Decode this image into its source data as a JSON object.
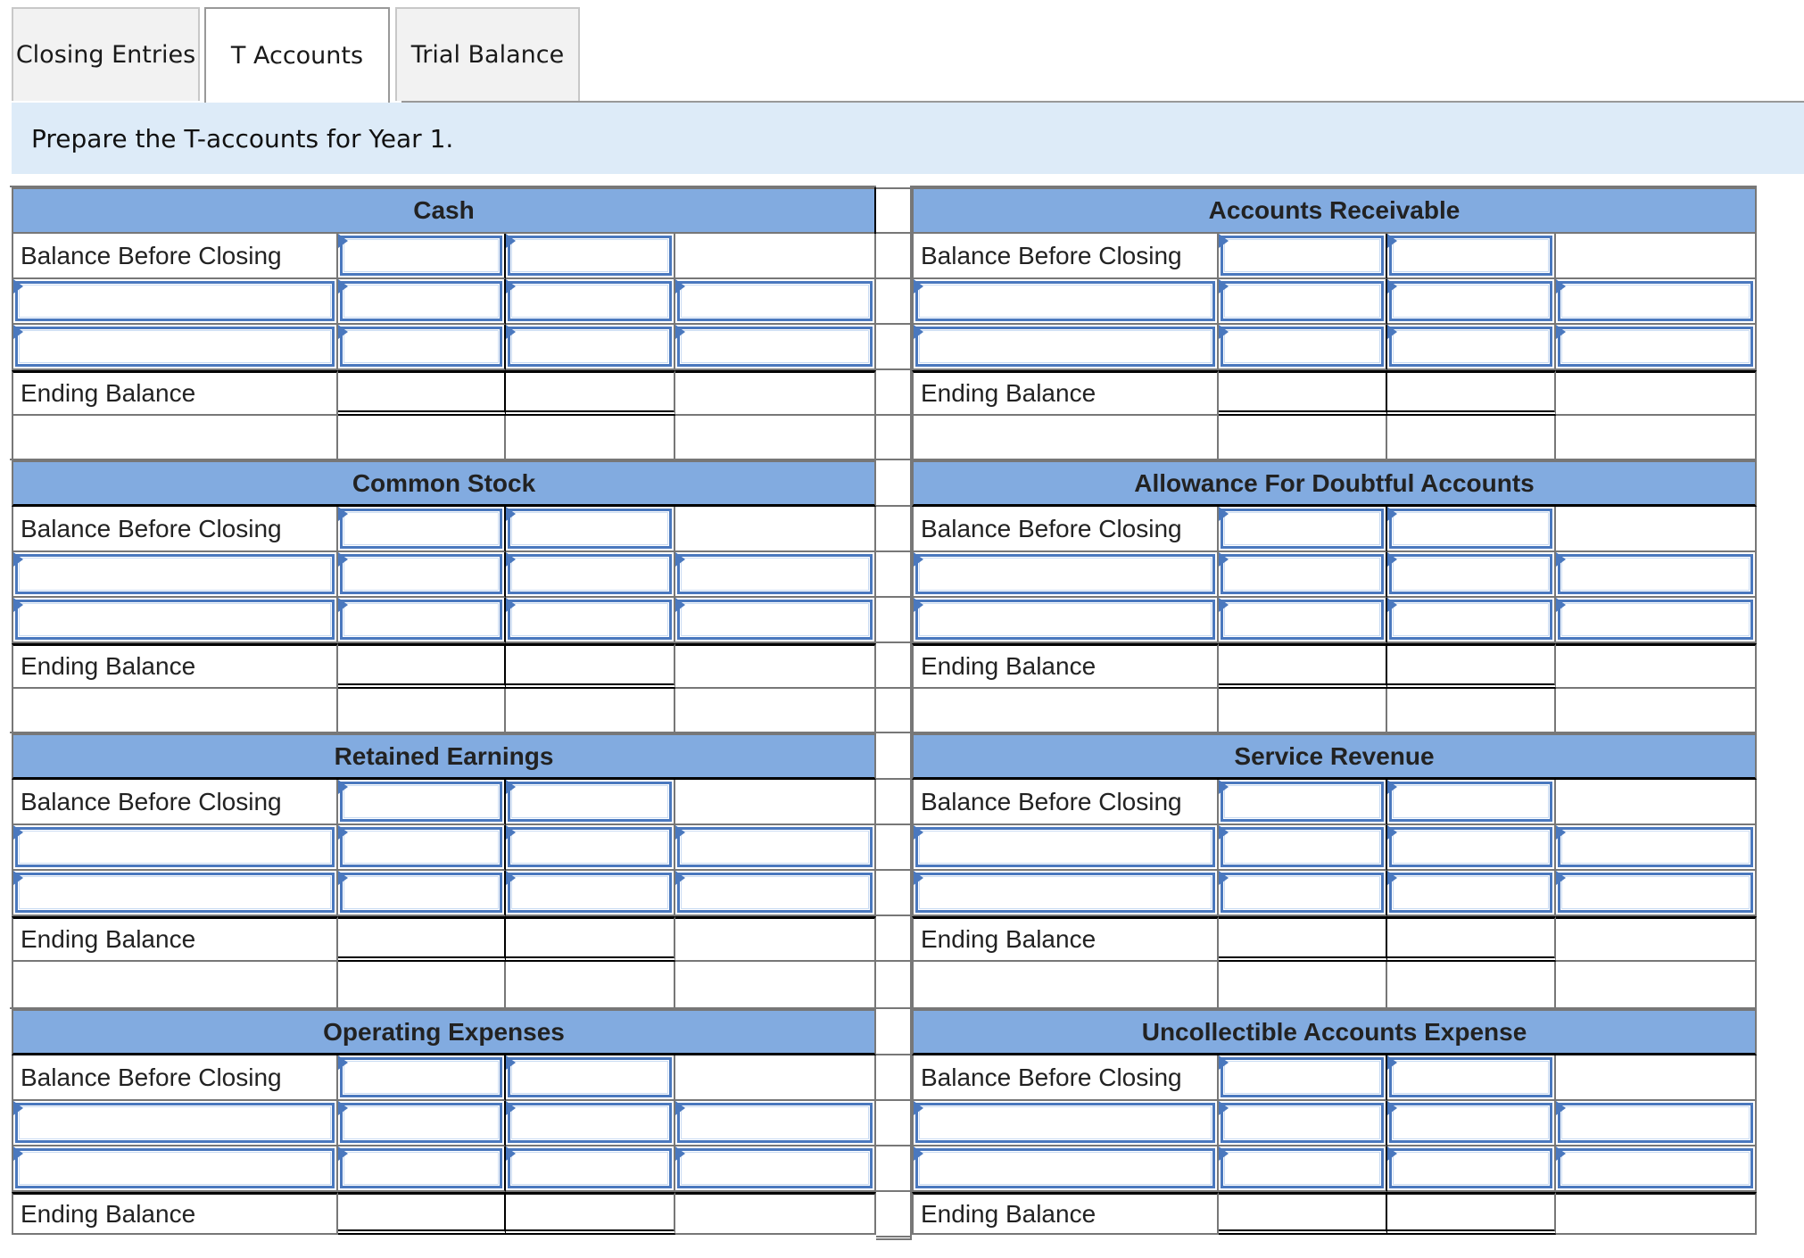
{
  "tabs": [
    {
      "label": "Closing Entries",
      "active": false
    },
    {
      "label": "T Accounts",
      "active": true
    },
    {
      "label": "Trial Balance",
      "active": false
    }
  ],
  "instruction": "Prepare the T-accounts for Year 1.",
  "row_labels": {
    "balance_before_closing": "Balance Before Closing",
    "ending_balance": "Ending Balance"
  },
  "colors": {
    "header_bg": "#82abe0",
    "banner_bg": "#ddebf8",
    "input_border": "#4a78be"
  },
  "accounts": [
    {
      "title": "Cash",
      "side": "left",
      "block": 0,
      "entries": [
        [
          "",
          "",
          "",
          ""
        ],
        [
          "",
          "",
          "",
          ""
        ]
      ],
      "balance_before_closing": [
        "",
        ""
      ],
      "ending_balance": [
        "",
        ""
      ]
    },
    {
      "title": "Accounts Receivable",
      "side": "right",
      "block": 0,
      "entries": [
        [
          "",
          "",
          "",
          ""
        ],
        [
          "",
          "",
          "",
          ""
        ]
      ],
      "balance_before_closing": [
        "",
        ""
      ],
      "ending_balance": [
        "",
        ""
      ]
    },
    {
      "title": "Common Stock",
      "side": "left",
      "block": 1,
      "entries": [
        [
          "",
          "",
          "",
          ""
        ],
        [
          "",
          "",
          "",
          ""
        ]
      ],
      "balance_before_closing": [
        "",
        ""
      ],
      "ending_balance": [
        "",
        ""
      ]
    },
    {
      "title": "Allowance For Doubtful Accounts",
      "side": "right",
      "block": 1,
      "entries": [
        [
          "",
          "",
          "",
          ""
        ],
        [
          "",
          "",
          "",
          ""
        ]
      ],
      "balance_before_closing": [
        "",
        ""
      ],
      "ending_balance": [
        "",
        ""
      ]
    },
    {
      "title": "Retained Earnings",
      "side": "left",
      "block": 2,
      "entries": [
        [
          "",
          "",
          "",
          ""
        ],
        [
          "",
          "",
          "",
          ""
        ]
      ],
      "balance_before_closing": [
        "",
        ""
      ],
      "ending_balance": [
        "",
        ""
      ]
    },
    {
      "title": "Service Revenue",
      "side": "right",
      "block": 2,
      "entries": [
        [
          "",
          "",
          "",
          ""
        ],
        [
          "",
          "",
          "",
          ""
        ]
      ],
      "balance_before_closing": [
        "",
        ""
      ],
      "ending_balance": [
        "",
        ""
      ]
    },
    {
      "title": "Operating Expenses",
      "side": "left",
      "block": 3,
      "entries": [
        [
          "",
          "",
          "",
          ""
        ],
        [
          "",
          "",
          "",
          ""
        ]
      ],
      "balance_before_closing": [
        "",
        ""
      ],
      "ending_balance": [
        "",
        ""
      ]
    },
    {
      "title": "Uncollectible Accounts Expense",
      "side": "right",
      "block": 3,
      "entries": [
        [
          "",
          "",
          "",
          ""
        ],
        [
          "",
          "",
          "",
          ""
        ]
      ],
      "balance_before_closing": [
        "",
        ""
      ],
      "ending_balance": [
        "",
        ""
      ]
    }
  ]
}
